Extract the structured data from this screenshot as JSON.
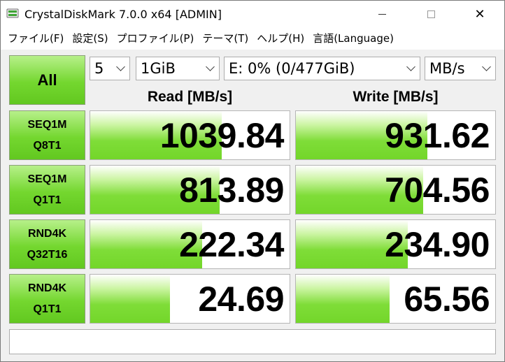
{
  "window": {
    "title": "CrystalDiskMark 7.0.0 x64 [ADMIN]",
    "minimize_label": "",
    "close_label": "✕"
  },
  "menu": [
    "ファイル(F)",
    "設定(S)",
    "プロファイル(P)",
    "テーマ(T)",
    "ヘルプ(H)",
    "言語(Language)"
  ],
  "controls": {
    "all_label": "All",
    "count": "5",
    "size": "1GiB",
    "drive": "E: 0% (0/477GiB)",
    "unit": "MB/s"
  },
  "headers": {
    "read": "Read [MB/s]",
    "write": "Write [MB/s]"
  },
  "tests": [
    {
      "line1": "SEQ1M",
      "line2": "Q8T1",
      "read": "1039.84",
      "write": "931.62",
      "read_fill": 0.66,
      "write_fill": 0.66
    },
    {
      "line1": "SEQ1M",
      "line2": "Q1T1",
      "read": "813.89",
      "write": "704.56",
      "read_fill": 0.65,
      "write_fill": 0.64
    },
    {
      "line1": "RND4K",
      "line2": "Q32T16",
      "read": "222.34",
      "write": "234.90",
      "read_fill": 0.56,
      "write_fill": 0.56
    },
    {
      "line1": "RND4K",
      "line2": "Q1T1",
      "read": "24.69",
      "write": "65.56",
      "read_fill": 0.4,
      "write_fill": 0.47
    }
  ],
  "comment": ""
}
